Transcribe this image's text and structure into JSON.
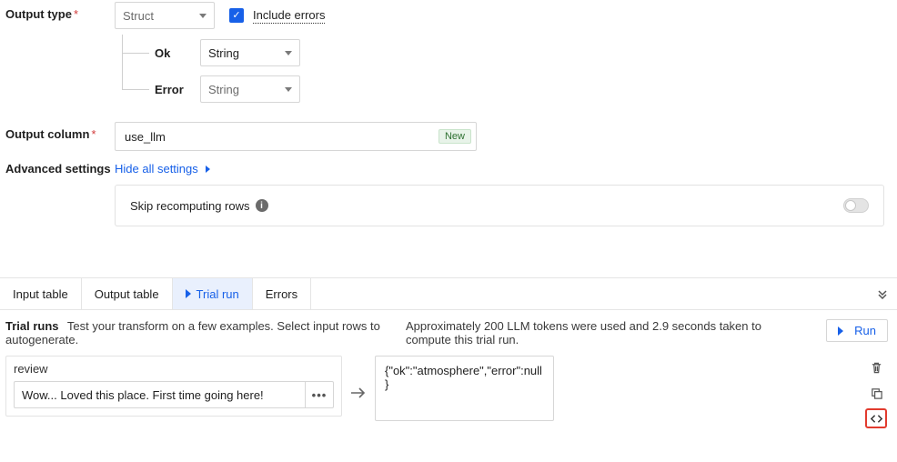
{
  "form": {
    "output_type_label": "Output type",
    "output_type_value": "Struct",
    "include_errors_label": "Include errors",
    "children": {
      "ok_label": "Ok",
      "ok_type": "String",
      "error_label": "Error",
      "error_type": "String"
    },
    "output_column_label": "Output column",
    "output_column_value": "use_llm",
    "new_badge": "New",
    "advanced_label": "Advanced settings",
    "hide_all": "Hide all settings",
    "skip_label": "Skip recomputing rows"
  },
  "tabs": {
    "input": "Input table",
    "output": "Output table",
    "trial": "Trial run",
    "errors": "Errors"
  },
  "trial": {
    "title": "Trial runs",
    "desc": "Test your transform on a few examples. Select input rows to autogenerate.",
    "stats": "Approximately 200 LLM tokens were used and 2.9 seconds taken to compute this trial run.",
    "run": "Run",
    "col": "review",
    "input_value": "Wow... Loved this place. First time going here!",
    "output_value": "{\"ok\":\"atmosphere\",\"error\":null}"
  }
}
